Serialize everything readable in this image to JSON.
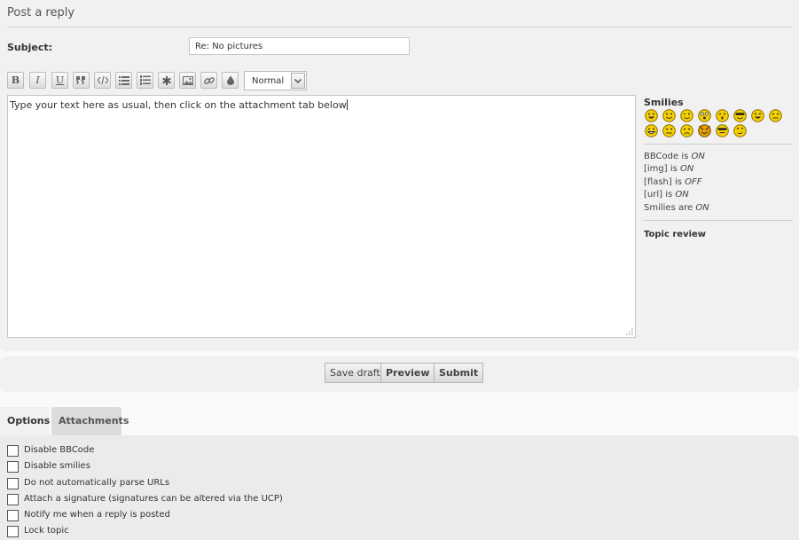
{
  "header": {
    "title": "Post a reply"
  },
  "subject": {
    "label": "Subject:",
    "value": "Re: No pictures"
  },
  "toolbar": {
    "buttons": [
      {
        "name": "bold",
        "glyph": "B"
      },
      {
        "name": "italic",
        "glyph": "I"
      },
      {
        "name": "underline",
        "glyph": "U"
      },
      {
        "name": "quote",
        "glyph": ""
      },
      {
        "name": "code",
        "glyph": ""
      },
      {
        "name": "list",
        "glyph": ""
      },
      {
        "name": "list-numbered",
        "glyph": ""
      },
      {
        "name": "list-item",
        "glyph": ""
      },
      {
        "name": "image",
        "glyph": ""
      },
      {
        "name": "link",
        "glyph": ""
      },
      {
        "name": "color",
        "glyph": ""
      }
    ],
    "font_size": "Normal"
  },
  "editor": {
    "text": "Type your text here as usual, then click on the attachment tab below"
  },
  "sidebar": {
    "smilies_title": "Smilies",
    "status": [
      {
        "prefix": "BBCode is ",
        "value": "ON"
      },
      {
        "prefix": "[img] is ",
        "value": "ON"
      },
      {
        "prefix": "[flash] is ",
        "value": "OFF"
      },
      {
        "prefix": "[url] is ",
        "value": "ON"
      },
      {
        "prefix": "Smilies are ",
        "value": "ON"
      }
    ],
    "topic_review": "Topic review"
  },
  "actions": {
    "save_draft": "Save draft",
    "preview": "Preview",
    "submit": "Submit"
  },
  "tabs": {
    "options": "Options",
    "attachments": "Attachments"
  },
  "options": [
    "Disable BBCode",
    "Disable smilies",
    "Do not automatically parse URLs",
    "Attach a signature (signatures can be altered via the UCP)",
    "Notify me when a reply is posted",
    "Lock topic"
  ],
  "colors": {
    "panel": "#f1f1f1",
    "smiley": "#f5d000"
  }
}
